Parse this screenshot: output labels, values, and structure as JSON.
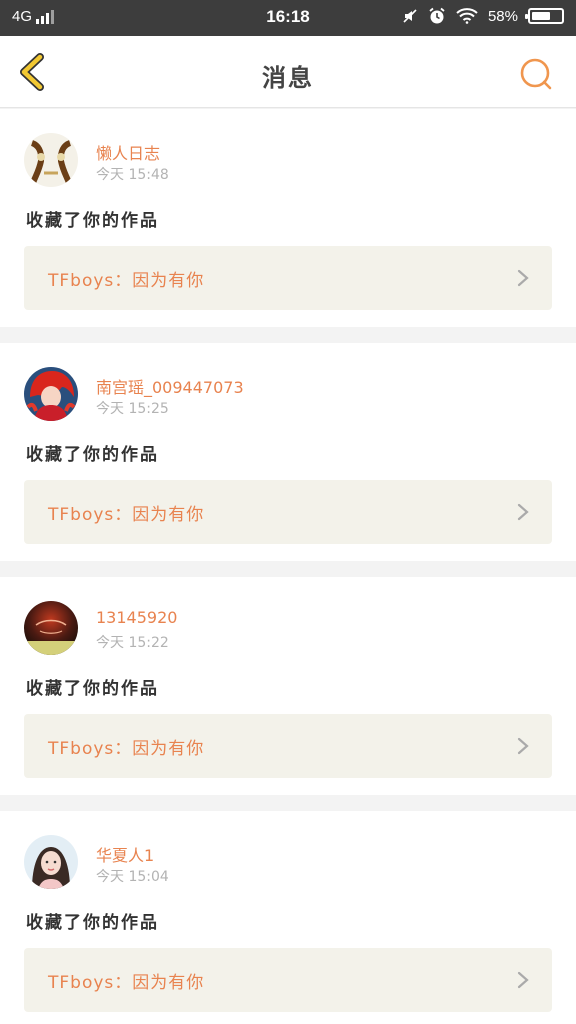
{
  "status_bar": {
    "network": "4G",
    "time": "16:18",
    "battery": "58%",
    "battery_level": 0.58
  },
  "header": {
    "title": "消息",
    "back_icon": "chevron-left-icon",
    "search_icon": "search-icon"
  },
  "colors": {
    "accent": "#e8834f",
    "back_arrow": "#f2c832",
    "card_bg": "#f3f2ea"
  },
  "messages": [
    {
      "name": "懒人日志",
      "time": "今天 15:48",
      "action": "收藏了你的作品",
      "work": "TFboys：因为有你"
    },
    {
      "name": "南宫瑶_009447073",
      "time": "今天 15:25",
      "action": "收藏了你的作品",
      "work": "TFboys：因为有你"
    },
    {
      "name": "13145920",
      "time": "今天 15:22",
      "action": "收藏了你的作品",
      "work": "TFboys：因为有你"
    },
    {
      "name": "华夏人1",
      "time": "今天 15:04",
      "action": "收藏了你的作品",
      "work": "TFboys：因为有你"
    }
  ]
}
